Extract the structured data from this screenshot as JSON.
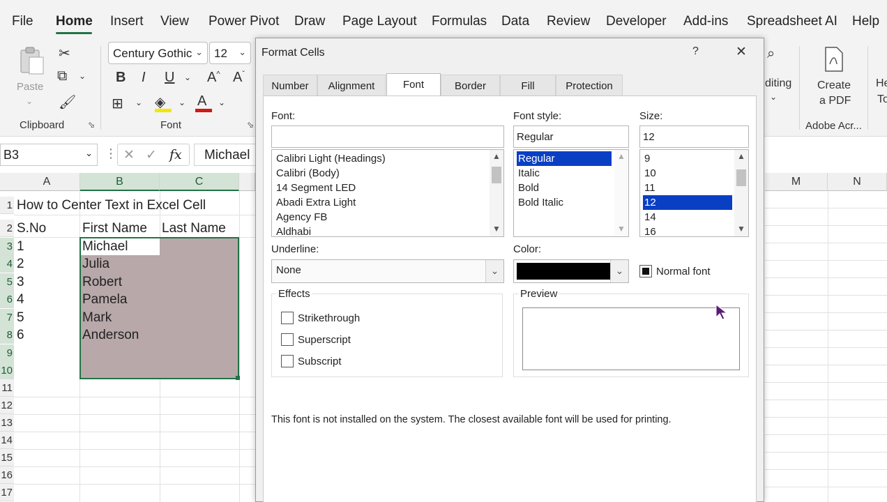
{
  "menu": {
    "items": [
      "File",
      "Home",
      "Insert",
      "View",
      "Power Pivot",
      "Draw",
      "Page Layout",
      "Formulas",
      "Data",
      "Review",
      "Developer",
      "Add-ins",
      "Spreadsheet AI",
      "Help"
    ],
    "active": "Home"
  },
  "ribbon": {
    "paste_label": "Paste",
    "clipboard_label": "Clipboard",
    "font_group_label": "Font",
    "font_name": "Century Gothic",
    "font_size": "12",
    "editing_label": "diting",
    "create_pdf_line1": "Create",
    "create_pdf_line2": "a PDF",
    "adobe_label": "Adobe Acr...",
    "cut_off_label_1": "He",
    "cut_off_label_2": "To"
  },
  "formula_bar": {
    "name_box": "B3",
    "content": "Michael"
  },
  "sheet": {
    "columns": [
      "A",
      "B",
      "C",
      "M",
      "N"
    ],
    "row_numbers": [
      "1",
      "2",
      "3",
      "4",
      "5",
      "6",
      "7",
      "8",
      "9",
      "10",
      "11",
      "12",
      "13",
      "14",
      "15",
      "16",
      "17"
    ],
    "title": "How to Center Text in Excel Cell",
    "headers": [
      "S.No",
      "First Name",
      "Last Name"
    ],
    "rows": [
      {
        "sno": "1",
        "first": "Michael"
      },
      {
        "sno": "2",
        "first": "Julia"
      },
      {
        "sno": "3",
        "first": "Robert"
      },
      {
        "sno": "4",
        "first": "Pamela"
      },
      {
        "sno": "5",
        "first": "Mark"
      },
      {
        "sno": "6",
        "first": "Anderson"
      }
    ]
  },
  "dialog": {
    "title": "Format Cells",
    "help": "?",
    "close": "✕",
    "tabs": [
      "Number",
      "Alignment",
      "Font",
      "Border",
      "Fill",
      "Protection"
    ],
    "active_tab": "Font",
    "font_label": "Font:",
    "font_value": "",
    "font_list": [
      "Calibri Light (Headings)",
      "Calibri (Body)",
      "14 Segment LED",
      "Abadi Extra Light",
      "Agency FB",
      "Aldhabi"
    ],
    "style_label": "Font style:",
    "style_value": "Regular",
    "style_list": [
      "Regular",
      "Italic",
      "Bold",
      "Bold Italic"
    ],
    "size_label": "Size:",
    "size_value": "12",
    "size_list": [
      "9",
      "10",
      "11",
      "12",
      "14",
      "16"
    ],
    "underline_label": "Underline:",
    "underline_value": "None",
    "color_label": "Color:",
    "color_value": "#000000",
    "normal_font_label": "Normal font",
    "effects_label": "Effects",
    "effects": [
      "Strikethrough",
      "Superscript",
      "Subscript"
    ],
    "preview_label": "Preview",
    "info_text": "This font is not installed on the system.  The closest available font will be used for printing."
  },
  "colors": {
    "excel_green": "#217346",
    "selection_fill": "#b8a8aa",
    "list_highlight": "#0a3fc4"
  }
}
